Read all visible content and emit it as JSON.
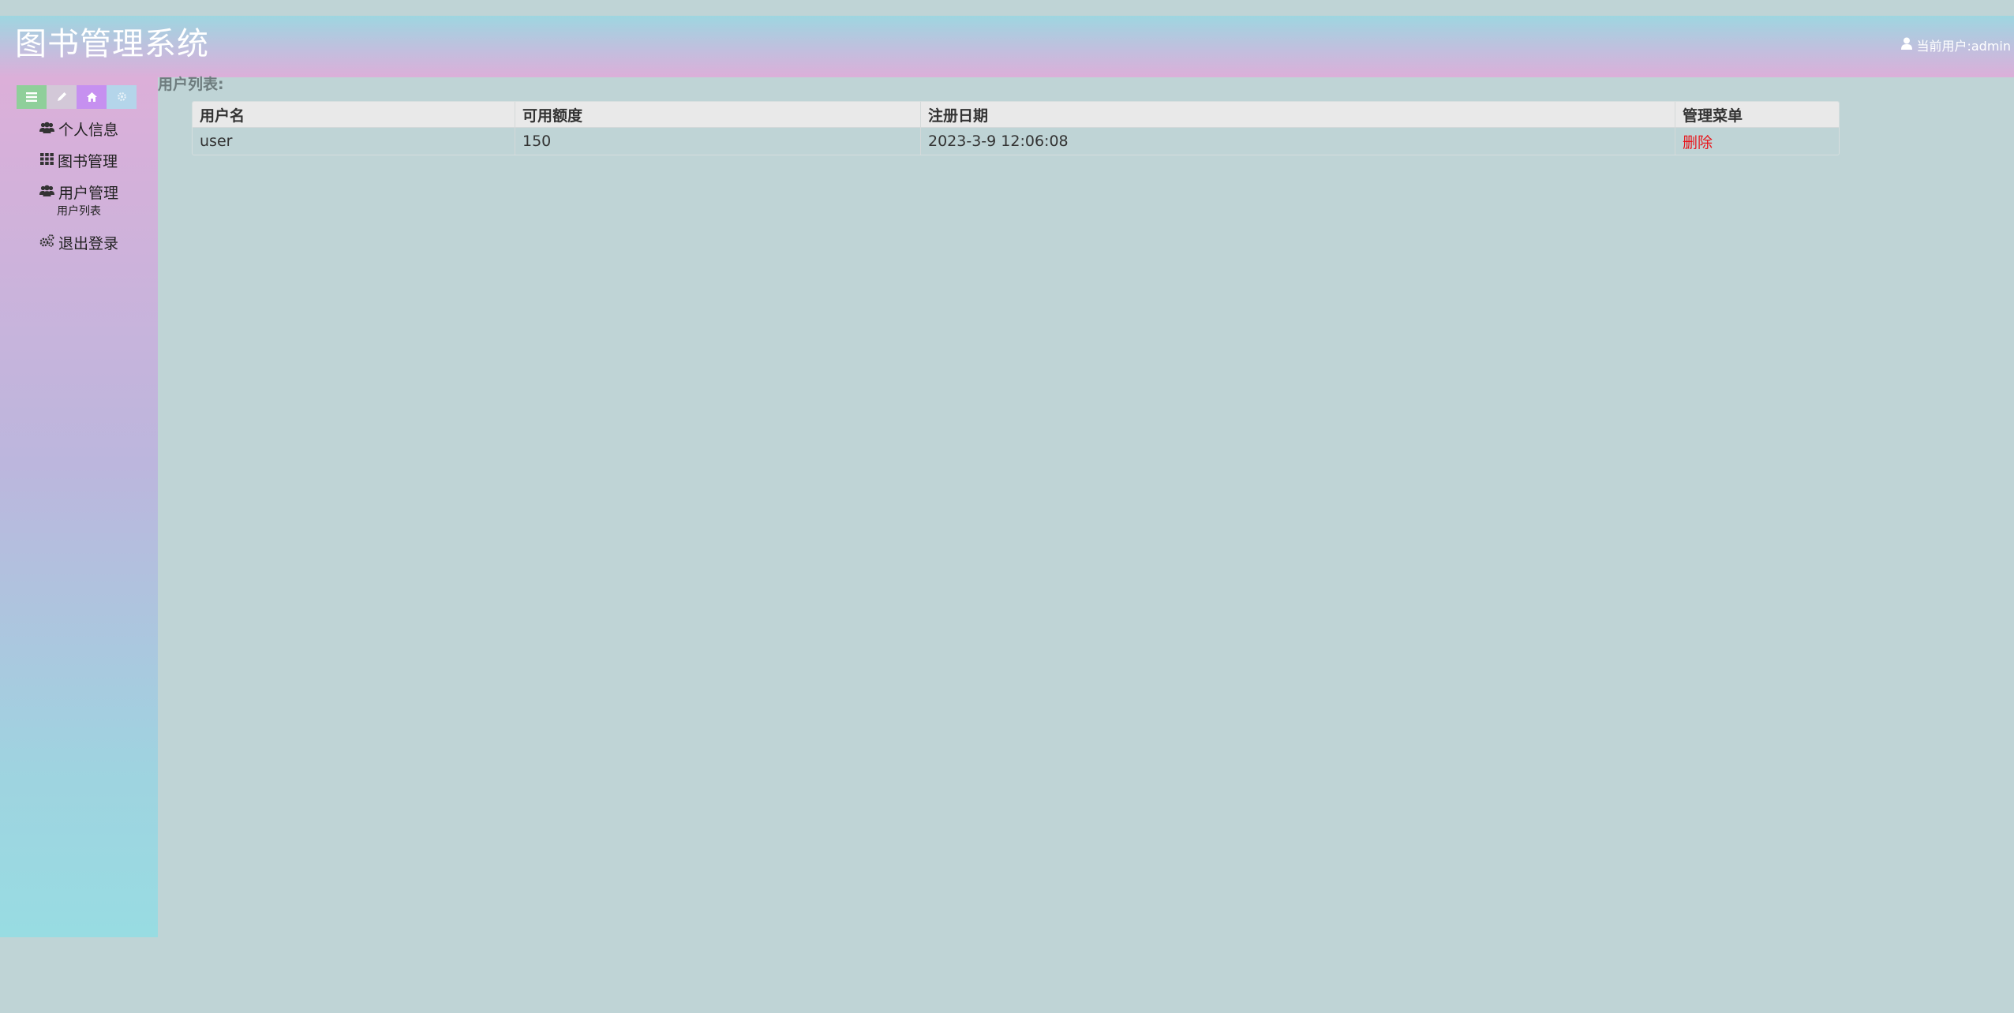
{
  "header": {
    "title": "图书管理系统",
    "current_user": "当前用户:admin"
  },
  "sidebar": {
    "shortcuts": [
      "list-icon",
      "pencil-icon",
      "home-icon",
      "gear-icon"
    ],
    "items": [
      {
        "label": "个人信息",
        "icon": "users-icon"
      },
      {
        "label": "图书管理",
        "icon": "grid-icon"
      },
      {
        "label": "用户管理",
        "icon": "users-icon",
        "children": [
          {
            "label": "用户列表"
          }
        ]
      },
      {
        "label": "退出登录",
        "icon": "gears-icon"
      }
    ]
  },
  "main": {
    "section_title": "用户列表:",
    "table": {
      "headers": [
        "用户名",
        "可用额度",
        "注册日期",
        "管理菜单"
      ],
      "rows": [
        {
          "username": "user",
          "quota": "150",
          "registered": "2023-3-9 12:06:08",
          "action": "删除"
        }
      ]
    }
  },
  "colors": {
    "background": "#bfd4d6",
    "delete_link": "#e8151b"
  }
}
